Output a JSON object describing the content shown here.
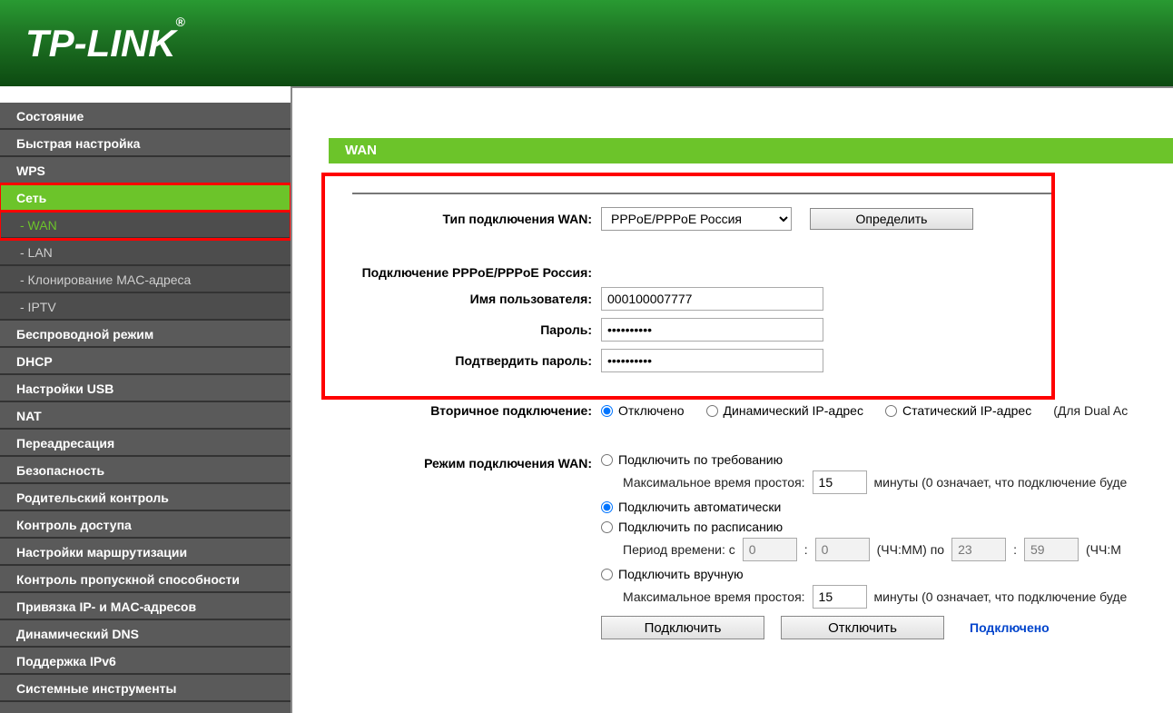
{
  "brand": "TP-LINK",
  "page_title": "WAN",
  "sidebar": {
    "items": [
      {
        "label": "Состояние",
        "active": false
      },
      {
        "label": "Быстрая настройка",
        "active": false
      },
      {
        "label": "WPS",
        "active": false
      },
      {
        "label": "Сеть",
        "active": true,
        "highlight": true,
        "sub": [
          {
            "label": "- WAN",
            "active": true,
            "highlight": true
          },
          {
            "label": "- LAN",
            "active": false
          },
          {
            "label": "- Клонирование MAC-адреса",
            "active": false
          },
          {
            "label": "- IPTV",
            "active": false
          }
        ]
      },
      {
        "label": "Беспроводной режим",
        "active": false
      },
      {
        "label": "DHCP",
        "active": false
      },
      {
        "label": "Настройки USB",
        "active": false
      },
      {
        "label": "NAT",
        "active": false
      },
      {
        "label": "Переадресация",
        "active": false
      },
      {
        "label": "Безопасность",
        "active": false
      },
      {
        "label": "Родительский контроль",
        "active": false
      },
      {
        "label": "Контроль доступа",
        "active": false
      },
      {
        "label": "Настройки маршрутизации",
        "active": false
      },
      {
        "label": "Контроль пропускной способности",
        "active": false
      },
      {
        "label": "Привязка IP- и MAC-адресов",
        "active": false
      },
      {
        "label": "Динамический DNS",
        "active": false
      },
      {
        "label": "Поддержка IPv6",
        "active": false
      },
      {
        "label": "Системные инструменты",
        "active": false
      }
    ]
  },
  "labels": {
    "wan_type": "Тип подключения WAN:",
    "pppoe_section": "Подключение PPPoE/PPPoE Россия:",
    "username": "Имя пользователя:",
    "password": "Пароль:",
    "confirm": "Подтвердить пароль:",
    "secondary": "Вторичное подключение:",
    "mode": "Режим подключения WAN:"
  },
  "wan": {
    "type_selected": "PPPoE/PPPoE Россия",
    "detect_btn": "Определить",
    "username": "000100007777",
    "password": "••••••••••",
    "confirm": "••••••••••"
  },
  "secondary": {
    "disabled": "Отключено",
    "dyn": "Динамический IP-адрес",
    "stat": "Статический IP-адрес",
    "note": "(Для Dual Ac",
    "selected": "disabled"
  },
  "mode": {
    "on_demand": "Подключить по требованию",
    "idle_label": "Максимальное время простоя:",
    "idle_value": "15",
    "idle_unit": "минуты (0 означает, что подключение буде",
    "auto": "Подключить автоматически",
    "schedule": "Подключить по расписанию",
    "period_label": "Период времени: с",
    "period_from_h": "0",
    "period_from_m": "0",
    "period_fmt1": "(ЧЧ:ММ) по",
    "period_to_h": "23",
    "period_to_m": "59",
    "period_fmt2": "(ЧЧ:М",
    "manual": "Подключить вручную",
    "manual_idle": "15",
    "selected": "auto"
  },
  "actions": {
    "connect": "Подключить",
    "disconnect": "Отключить",
    "status": "Подключено"
  }
}
